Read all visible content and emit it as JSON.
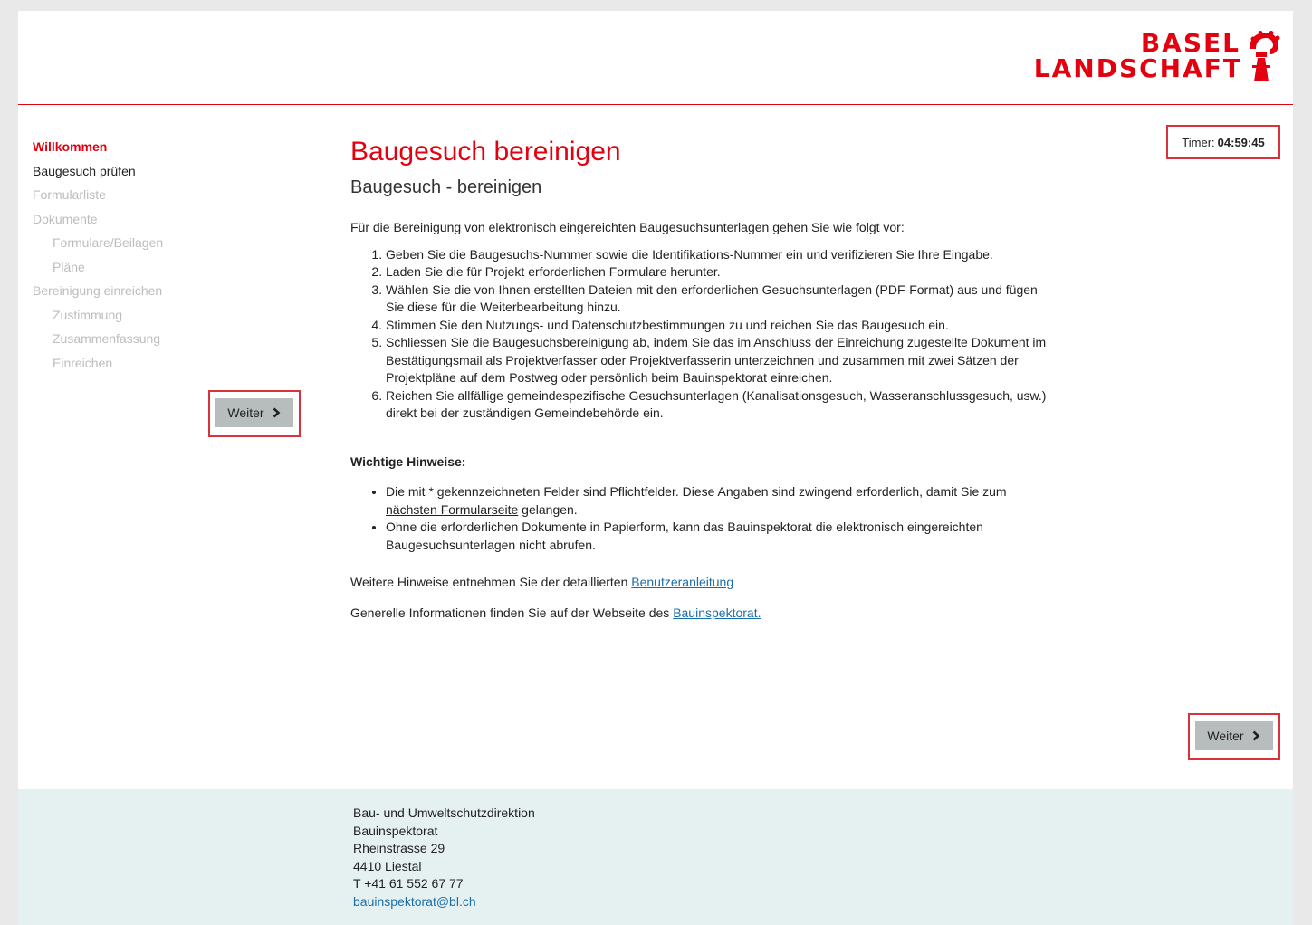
{
  "logo": {
    "line1": "BASEL",
    "line2": "LANDSCHAFT",
    "brand_color": "#e3000f"
  },
  "sidebar": {
    "items": [
      {
        "label": "Willkommen",
        "state": "active"
      },
      {
        "label": "Baugesuch prüfen",
        "state": "enabled"
      },
      {
        "label": "Formularliste",
        "state": "disabled"
      },
      {
        "label": "Dokumente",
        "state": "disabled"
      },
      {
        "label": "Formulare/Beilagen",
        "state": "disabled"
      },
      {
        "label": "Pläne",
        "state": "disabled"
      },
      {
        "label": "Bereinigung einreichen",
        "state": "disabled"
      },
      {
        "label": "Zustimmung",
        "state": "disabled"
      },
      {
        "label": "Zusammenfassung",
        "state": "disabled"
      },
      {
        "label": "Einreichen",
        "state": "disabled"
      }
    ],
    "next_button": {
      "label": "Weiter",
      "icon": "chevron-right-icon"
    }
  },
  "timer": {
    "label": "Timer:",
    "value": "04:59:45"
  },
  "main": {
    "title": "Baugesuch bereinigen",
    "subtitle": "Baugesuch - bereinigen",
    "intro": "Für die Bereinigung von elektronisch eingereichten Baugesuchsunterlagen gehen Sie wie folgt vor:",
    "steps": [
      "Geben Sie die Baugesuchs-Nummer sowie die Identifikations-Nummer ein und verifizieren Sie Ihre Eingabe.",
      "Laden Sie die für Projekt erforderlichen Formulare herunter.",
      "Wählen Sie die von Ihnen erstellten Dateien mit den erforderlichen Gesuchsunterlagen (PDF-Format) aus und fügen Sie diese für die Weiterbearbeitung hinzu.",
      "Stimmen Sie den Nutzungs- und Datenschutzbestimmungen zu und reichen Sie das Baugesuch ein.",
      "Schliessen Sie die Baugesuchsbereinigung ab, indem Sie das im Anschluss der Einreichung zugestellte Dokument im Bestätigungsmail als Projektverfasser oder Projektverfasserin unterzeichnen und zusammen mit zwei Sätzen der Projektpläne auf dem Postweg oder persönlich beim Bauinspektorat einreichen.",
      "Reichen Sie allfällige gemeindespezifische Gesuchsunterlagen (Kanalisationsgesuch, Wasseranschlussgesuch, usw.) direkt bei der zuständigen Gemeindebehörde ein."
    ],
    "hints_title": "Wichtige Hinweise:",
    "hint1_before": "Die mit * gekennzeichneten Felder sind Pflichtfelder. Diese Angaben sind zwingend erforderlich, damit Sie zum ",
    "hint1_underlined": "nächsten Formularseite",
    "hint1_after": " gelangen.",
    "hint2": "Ohne die erforderlichen Dokumente in Papierform, kann das Bauinspektorat die elektronisch eingereichten Baugesuchsunterlagen nicht abrufen.",
    "manual_text": "Weitere Hinweise entnehmen Sie der detaillierten ",
    "manual_link": "Benutzeranleitung",
    "info_text": "Generelle Informationen finden Sie auf der Webseite des ",
    "info_link": "Bauinspektorat.",
    "next_button": {
      "label": "Weiter",
      "icon": "chevron-right-icon"
    }
  },
  "footer": {
    "org": "Bau- und Umweltschutzdirektion",
    "dept": "Bauinspektorat",
    "street": "Rheinstrasse 29",
    "city": "4410 Liestal",
    "phone": "T +41 61 552 67 77",
    "email": "bauinspektorat@bl.ch"
  }
}
